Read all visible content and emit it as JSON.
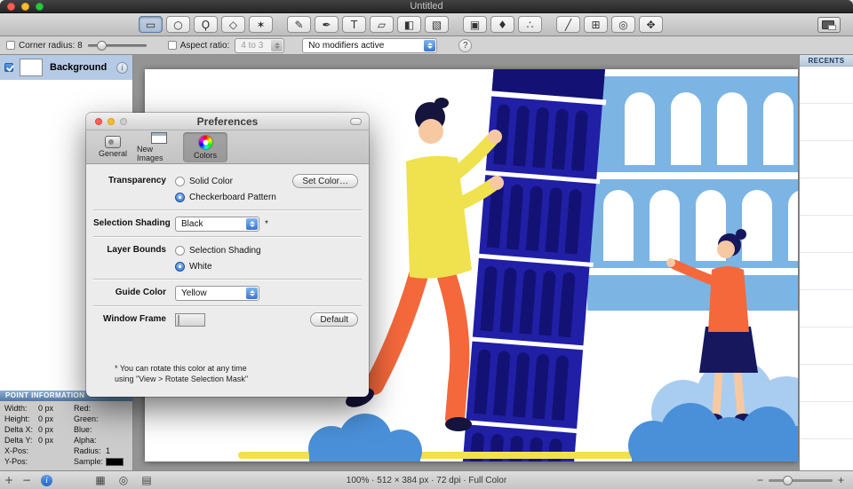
{
  "titlebar": {
    "title": "Untitled"
  },
  "toolbar": {
    "groups": [
      [
        {
          "name": "rect-select-tool",
          "glyph": "▭",
          "selected": true
        },
        {
          "name": "ellipse-select-tool",
          "glyph": "○"
        },
        {
          "name": "lasso-tool",
          "glyph": "Ϙ"
        },
        {
          "name": "polygon-select-tool",
          "glyph": "◇"
        },
        {
          "name": "magic-wand-tool",
          "glyph": "✶"
        }
      ],
      [
        {
          "name": "pencil-tool",
          "glyph": "✎"
        },
        {
          "name": "brush-tool",
          "glyph": "✒"
        },
        {
          "name": "text-tool",
          "glyph": "T"
        },
        {
          "name": "eraser-tool",
          "glyph": "▱"
        },
        {
          "name": "bucket-tool",
          "glyph": "◧"
        },
        {
          "name": "gradient-tool",
          "glyph": "▧"
        }
      ],
      [
        {
          "name": "clone-stamp-tool",
          "glyph": "▣"
        },
        {
          "name": "smudge-tool",
          "glyph": "♦"
        },
        {
          "name": "effects-tool",
          "glyph": "∴"
        }
      ],
      [
        {
          "name": "eyedropper-tool",
          "glyph": "╱"
        },
        {
          "name": "crop-tool",
          "glyph": "⊞"
        },
        {
          "name": "zoom-tool",
          "glyph": "◎"
        },
        {
          "name": "move-tool",
          "glyph": "✥"
        }
      ]
    ]
  },
  "options_bar": {
    "corner_radius_label": "Corner radius: 8",
    "aspect_ratio_label": "Aspect ratio:",
    "aspect_ratio_value": "4 to 3",
    "modifiers_value": "No modifiers active",
    "help_label": "?"
  },
  "layers_panel": {
    "layers": [
      {
        "name": "Background",
        "visible": true,
        "selected": true,
        "info_glyph": "i"
      }
    ]
  },
  "point_info": {
    "title": "POINT INFORMATION",
    "rows": [
      {
        "l1": "Width:",
        "v1": "0 px",
        "l2": "Red:",
        "v2": ""
      },
      {
        "l1": "Height:",
        "v1": "0 px",
        "l2": "Green:",
        "v2": ""
      },
      {
        "l1": "Delta X:",
        "v1": "0 px",
        "l2": "Blue:",
        "v2": ""
      },
      {
        "l1": "Delta Y:",
        "v1": "0 px",
        "l2": "Alpha:",
        "v2": ""
      },
      {
        "l1": "X-Pos:",
        "v1": "",
        "l2": "Radius:",
        "v2": "1"
      },
      {
        "l1": "Y-Pos:",
        "v1": "",
        "l2": "Sample:",
        "v2": "",
        "sample_swatch": "#000000"
      }
    ]
  },
  "recents_panel": {
    "title": "RECENTS",
    "row_count": 10
  },
  "canvas": {
    "illustration": "leaning-tower-of-pisa-scene",
    "palette": {
      "tower_blue": "#201fa6",
      "tower_dark": "#131274",
      "colosseum_blue": "#7cb4e4",
      "light_cloud_blue": "#a9cdf0",
      "cloud_blue": "#4a90d9",
      "sweater_yellow": "#f0e14e",
      "ground_yellow": "#f2e14c",
      "orange": "#f4683c",
      "skin": "#f7c9a2",
      "navy": "#17175e",
      "background": "#ffffff"
    }
  },
  "preferences": {
    "title": "Preferences",
    "tabs": [
      {
        "label": "General",
        "selected": false
      },
      {
        "label": "New Images",
        "selected": false
      },
      {
        "label": "Colors",
        "selected": true
      }
    ],
    "transparency": {
      "label": "Transparency",
      "radio_solid": "Solid Color",
      "radio_checker": "Checkerboard Pattern",
      "selected": "Checkerboard Pattern",
      "set_color_button": "Set Color…"
    },
    "selection_shading": {
      "label": "Selection Shading",
      "value": "Black",
      "asterisk": "*"
    },
    "layer_bounds": {
      "label": "Layer Bounds",
      "radio_shading": "Selection Shading",
      "radio_white": "White",
      "selected": "White"
    },
    "guide_color": {
      "label": "Guide Color",
      "value": "Yellow"
    },
    "window_frame": {
      "label": "Window Frame",
      "default_button": "Default"
    },
    "footnote_line1": "* You can rotate this color at any time",
    "footnote_line2": "using \"View > Rotate Selection Mask\""
  },
  "status_bar": {
    "left_buttons": [
      {
        "name": "zoom-in-button",
        "glyph": "+"
      },
      {
        "name": "zoom-out-button",
        "glyph": "−"
      }
    ],
    "info_button_glyph": "i",
    "mid_buttons": [
      {
        "name": "grid-button",
        "glyph": "▦"
      },
      {
        "name": "crosshair-button",
        "glyph": "◎"
      },
      {
        "name": "layers-button",
        "glyph": "▤"
      }
    ],
    "info_text": "100% · 512 × 384 px · 72 dpi · Full Color",
    "right": {
      "minus": "−",
      "plus": "+"
    }
  }
}
